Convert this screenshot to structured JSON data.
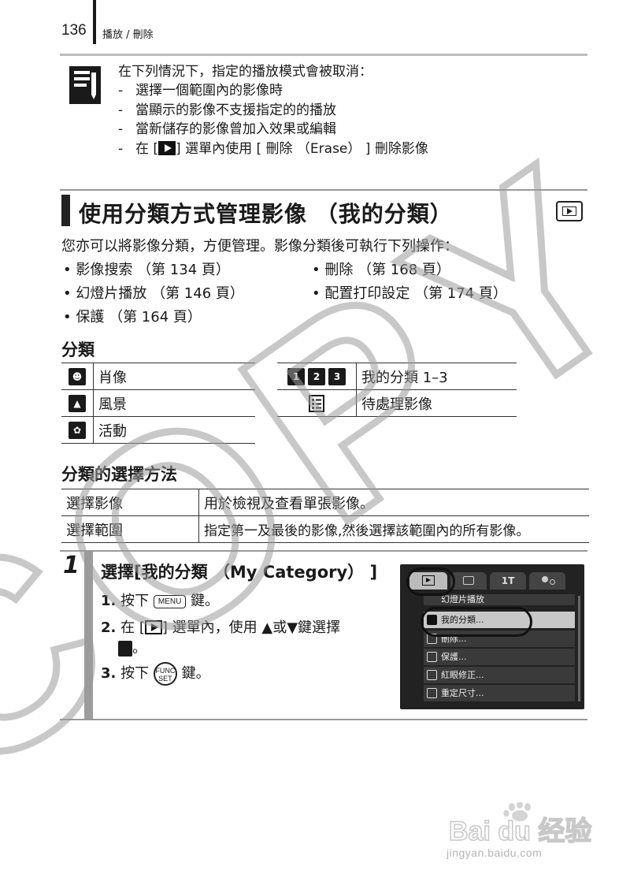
{
  "header": {
    "page_number": "136",
    "section": "播放 / 刪除"
  },
  "note": {
    "lead": "在下列情況下，指定的播放模式會被取消：",
    "items": [
      "選擇一個範圍內的影像時",
      "當顯示的影像不支援指定的的播放",
      "當新儲存的影像曾加入效果或編輯"
    ],
    "last_prefix": "在 [",
    "last_suffix": "] 選單內使用 [ 刪除 （Erase） ] 刪除影像"
  },
  "title": "使用分類方式管理影像 （我的分類）",
  "intro": "您亦可以將影像分類，方便管理。影像分類後可執行下列操作：",
  "bullets": [
    "影像搜索 （第 134 頁）",
    "刪除 （第 168 頁）",
    "幻燈片播放 （第 146 頁）",
    "配置打印設定 （第 174 頁）",
    "保護 （第 164 頁）"
  ],
  "categories": {
    "heading": "分類",
    "left": [
      "肖像",
      "風景",
      "活動"
    ],
    "right": [
      "我的分類 1–3",
      "待處理影像"
    ],
    "mycat_numbers": [
      "1",
      "2",
      "3"
    ]
  },
  "selection": {
    "heading": "分類的選擇方法",
    "rows": [
      {
        "method": "選擇影像",
        "desc": "用於檢視及查看單張影像。"
      },
      {
        "method": "選擇範圍",
        "desc": "指定第一及最後的影像,然後選擇該範圍內的所有影像。"
      }
    ]
  },
  "step": {
    "number": "1",
    "title": "選擇[我的分類 （My Category） ]",
    "s1_num": "1.",
    "s1_a": "按下",
    "s1_key": "MENU",
    "s1_b": "鍵。",
    "s2_num": "2.",
    "s2_a": "在 [",
    "s2_b": "] 選單內，使用",
    "s2_up": "▲",
    "s2_or": "或",
    "s2_down": "▼",
    "s2_c": "鍵選擇",
    "s2_end": "。",
    "s3_num": "3.",
    "s3_a": "按下",
    "s3_key_top": "FUNC",
    "s3_key_bot": "SET",
    "s3_b": "鍵。"
  },
  "camera_menu": {
    "tab_labels": [
      "1T"
    ],
    "rows": [
      "幻燈片播放",
      "我的分類...",
      "刪除...",
      "保護...",
      "紅眼修正...",
      "重定尺寸..."
    ]
  },
  "watermark": {
    "text": "COPY",
    "logo_text": "Bai du 经验",
    "url": "jingyan.baidu.com"
  }
}
